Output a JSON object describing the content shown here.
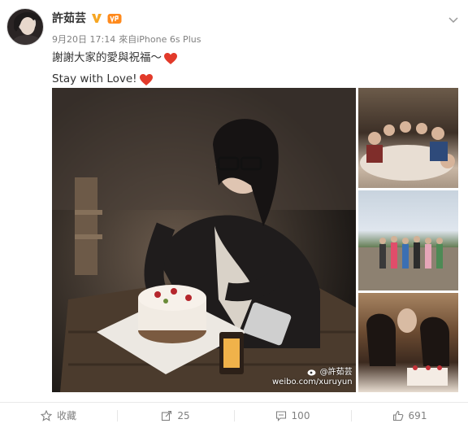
{
  "header": {
    "user_name": "許茹芸",
    "date": "9月20日 17:14",
    "source": "來自iPhone 6s Plus"
  },
  "post": {
    "line1": "謝謝大家的愛與祝福～",
    "line2": "Stay with Love!"
  },
  "watermark": {
    "handle": "@許茹芸",
    "url": "weibo.com/xuruyun"
  },
  "actions": {
    "favorite_label": "收藏",
    "repost_count": "25",
    "comment_count": "100",
    "like_count": "691"
  },
  "colors": {
    "text": "#333333",
    "meta": "#808080",
    "verified": "#f6a623",
    "heart": "#e23a2a"
  }
}
